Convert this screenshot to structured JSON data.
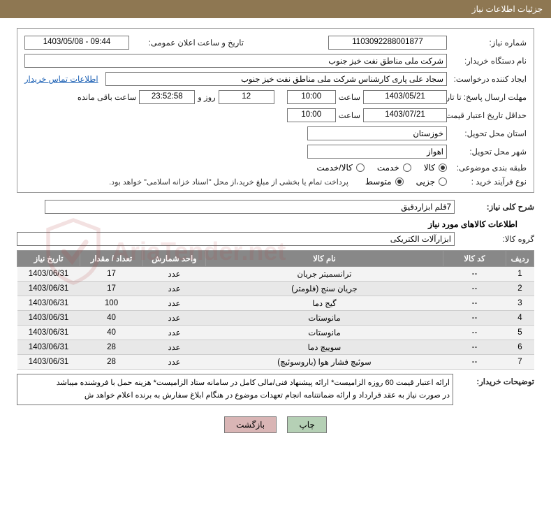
{
  "header": "جزئیات اطلاعات نیاز",
  "labels": {
    "need_no": "شماره نیاز:",
    "announce_dt": "تاریخ و ساعت اعلان عمومی:",
    "org": "نام دستگاه خریدار:",
    "requester": "ایجاد کننده درخواست:",
    "contact_link": "اطلاعات تماس خریدار",
    "reply_deadline": "مهلت ارسال پاسخ: تا تاریخ:",
    "time": "ساعت",
    "days_left_post": "روز و",
    "remaining": "ساعت باقی مانده",
    "price_valid": "حداقل تاریخ اعتبار قیمت: تا تاریخ:",
    "province": "استان محل تحویل:",
    "city": "شهر محل تحویل:",
    "classify": "طبقه بندی موضوعی:",
    "classify_goods": "کالا",
    "classify_service": "خدمت",
    "classify_both": "کالا/خدمت",
    "process": "نوع فرآیند خرید :",
    "process_small": "جزیی",
    "process_medium": "متوسط",
    "process_note": "پرداخت تمام یا بخشی از مبلغ خرید،از محل \"اسناد خزانه اسلامی\" خواهد بود.",
    "overall": "شرح کلی نیاز:",
    "goods_section": "اطلاعات کالاهای مورد نیاز",
    "goods_group": "گروه کالا:",
    "buyer_notes": "توضیحات خریدار:"
  },
  "values": {
    "need_no": "1103092288001877",
    "announce_dt": "1403/05/08 - 09:44",
    "org": "شرکت ملی مناطق نفت خیز جنوب",
    "requester": "سجاد علی پاری کارشناس شرکت ملی مناطق نفت خیز جنوب",
    "reply_date": "1403/05/21",
    "reply_time": "10:00",
    "days_left": "12",
    "remaining_time": "23:52:58",
    "price_valid_date": "1403/07/21",
    "price_valid_time": "10:00",
    "province": "خوزستان",
    "city": "اهواز",
    "overall_desc": "7قلم ابزاردقیق",
    "goods_group": "ابزارآلات الکتریکی",
    "buyer_notes_text": "ارائه اعتبار قیمت 60 روزه الزامیست* ارائه پیشنهاد فنی/مالی کامل در سامانه ستاد الزامیست* هزینه حمل با فروشنده میباشد\nدر صورت نیاز به عقد قرارداد و ارائه ضمانتنامه انجام تعهدات موضوع در هنگام ابلاغ سفارش به برنده اعلام خواهد ش"
  },
  "selected": {
    "classify": "goods",
    "process": "medium"
  },
  "table": {
    "headers": {
      "row": "ردیف",
      "code": "کد کالا",
      "name": "نام کالا",
      "unit": "واحد شمارش",
      "qty": "تعداد / مقدار",
      "need_date": "تاریخ نیاز"
    },
    "rows": [
      {
        "row": "1",
        "code": "--",
        "name": "ترانسمیتر جریان",
        "unit": "عدد",
        "qty": "17",
        "date": "1403/06/31"
      },
      {
        "row": "2",
        "code": "--",
        "name": "جریان سنج (فلومتر)",
        "unit": "عدد",
        "qty": "17",
        "date": "1403/06/31"
      },
      {
        "row": "3",
        "code": "--",
        "name": "گیج دما",
        "unit": "عدد",
        "qty": "100",
        "date": "1403/06/31"
      },
      {
        "row": "4",
        "code": "--",
        "name": "مانوستات",
        "unit": "عدد",
        "qty": "40",
        "date": "1403/06/31"
      },
      {
        "row": "5",
        "code": "--",
        "name": "مانوستات",
        "unit": "عدد",
        "qty": "40",
        "date": "1403/06/31"
      },
      {
        "row": "6",
        "code": "--",
        "name": "سوییچ دما",
        "unit": "عدد",
        "qty": "28",
        "date": "1403/06/31"
      },
      {
        "row": "7",
        "code": "--",
        "name": "سوئیچ فشار هوا (باروسوئیچ)",
        "unit": "عدد",
        "qty": "28",
        "date": "1403/06/31"
      }
    ]
  },
  "buttons": {
    "print": "چاپ",
    "back": "بازگشت"
  },
  "watermark": "AriaTender.net"
}
